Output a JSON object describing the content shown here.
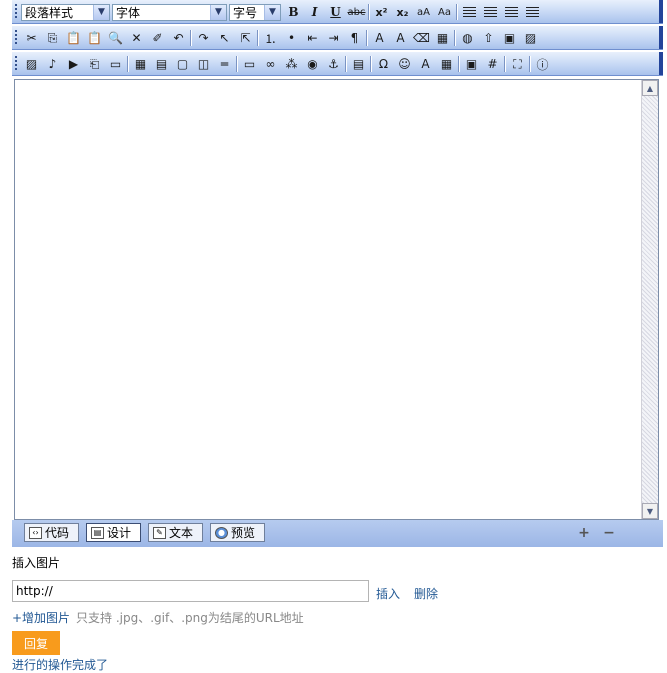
{
  "toolbar": {
    "paragraph_style": "段落样式",
    "font_family": "字体",
    "font_size": "字号",
    "format_buttons": [
      "B",
      "I",
      "U",
      "abc",
      "x²",
      "x₂",
      "aA",
      "Aa"
    ],
    "row1_align_icons": [
      "align-left-icon",
      "align-center-icon",
      "align-right-icon",
      "align-justify-icon"
    ],
    "row2_icons": [
      "cut-icon",
      "copy-icon",
      "paste-icon",
      "paste-text-icon",
      "find-icon",
      "delete-icon",
      "clean-icon",
      "undo-icon",
      "redo-icon",
      "pointer-icon",
      "select-all-icon",
      "ordered-list-icon",
      "unordered-list-icon",
      "outdent-icon",
      "indent-icon",
      "paragraph-icon",
      "forecolor-icon",
      "backcolor-icon",
      "eraser-icon",
      "table-props-icon",
      "globe-icon",
      "upload-icon",
      "flash-icon",
      "image-icon"
    ],
    "row3_icons": [
      "insert-image-icon",
      "insert-media-icon",
      "insert-video-icon",
      "attachment-icon",
      "new-page-icon",
      "table-icon",
      "template-icon",
      "box-icon",
      "frame-icon",
      "hr-icon",
      "form-icon",
      "link-icon",
      "unlink-icon",
      "web-link-icon",
      "anchor-icon",
      "date-icon",
      "special-char-icon",
      "emoticon-icon",
      "font-icon",
      "excel-icon",
      "preview-icon",
      "grid-icon",
      "fullscreen-icon",
      "about-icon"
    ],
    "row3_text_glyphs": {
      "special_char": "Ω",
      "emoticon": "☺",
      "anchor": "⚓",
      "grid": "#",
      "about": "i"
    }
  },
  "modes": [
    {
      "label": "代码",
      "icon": "code-icon"
    },
    {
      "label": "设计",
      "icon": "design-icon"
    },
    {
      "label": "文本",
      "icon": "text-icon"
    },
    {
      "label": "预览",
      "icon": "preview-globe-icon"
    }
  ],
  "resize": {
    "expand": "+",
    "shrink": "−"
  },
  "form": {
    "insert_image_label": "插入图片",
    "url_value": "http://",
    "insert_link": "插入",
    "delete_link": "删除",
    "add_image_link": "+增加图片",
    "hint": "只支持 .jpg、.gif、.png为结尾的URL地址",
    "reply_button": "回复",
    "status_text": "进行的操作完成了"
  },
  "colors": {
    "toolbar_gradient_top": "#e8f0fc",
    "toolbar_gradient_bottom": "#a9c2ec",
    "link_blue": "#235994",
    "reply_orange": "#f89b1c"
  }
}
